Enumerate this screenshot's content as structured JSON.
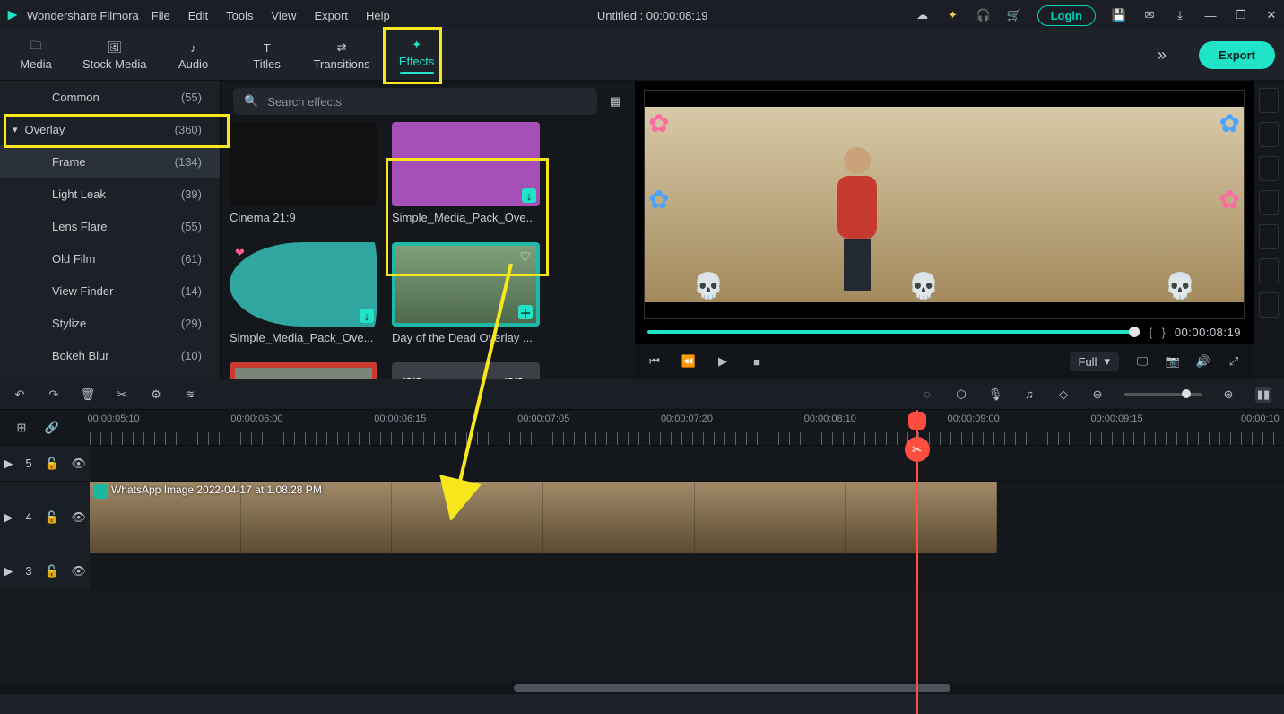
{
  "accent": "#20e3c8",
  "highlight": "#f8e71c",
  "title": {
    "brand": "Wondershare Filmora",
    "menus": [
      "File",
      "Edit",
      "Tools",
      "View",
      "Export",
      "Help"
    ],
    "document": "Untitled : 00:00:08:19",
    "login": "Login"
  },
  "tabs": {
    "items": [
      {
        "id": "media",
        "label": "Media"
      },
      {
        "id": "stock",
        "label": "Stock Media"
      },
      {
        "id": "audio",
        "label": "Audio"
      },
      {
        "id": "titles",
        "label": "Titles"
      },
      {
        "id": "transitions",
        "label": "Transitions"
      },
      {
        "id": "effects",
        "label": "Effects",
        "active": true
      }
    ],
    "export": "Export"
  },
  "categories": {
    "top": {
      "label": "Common",
      "count": "(55)"
    },
    "expanded": {
      "label": "Overlay",
      "count": "(360)"
    },
    "children": [
      {
        "label": "Frame",
        "count": "(134)",
        "selected": true
      },
      {
        "label": "Light Leak",
        "count": "(39)"
      },
      {
        "label": "Lens Flare",
        "count": "(55)"
      },
      {
        "label": "Old Film",
        "count": "(61)"
      },
      {
        "label": "View Finder",
        "count": "(14)"
      },
      {
        "label": "Stylize",
        "count": "(29)"
      },
      {
        "label": "Bokeh Blur",
        "count": "(10)"
      }
    ]
  },
  "search": {
    "placeholder": "Search effects"
  },
  "assets": [
    {
      "name": "Cinema 21:9",
      "dl": true
    },
    {
      "name": "Simple_Media_Pack_Ove...",
      "dl": true
    },
    {
      "name": "Simple_Media_Pack_Ove...",
      "dl": true,
      "heart": true
    },
    {
      "name": "Day of the Dead Overlay ...",
      "dl": false,
      "highlight": true,
      "heart": true,
      "plus": true
    },
    {
      "name": "",
      "dl": true
    },
    {
      "name": "",
      "dl": true
    }
  ],
  "preview": {
    "quality": "Full",
    "timecode": "00:00:08:19"
  },
  "ruler": {
    "labels": [
      "00:00:05:10",
      "00:00:06:00",
      "00:00:06:15",
      "00:00:07:05",
      "00:00:07:20",
      "00:00:08:10",
      "00:00:09:00",
      "00:00:09:15",
      "00:00:10"
    ],
    "playhead_pct": 69.2
  },
  "tracks": {
    "t5": "5",
    "t4": "4",
    "t3": "3",
    "clip_label": "WhatsApp Image 2022-04-17 at 1.08.28 PM"
  }
}
